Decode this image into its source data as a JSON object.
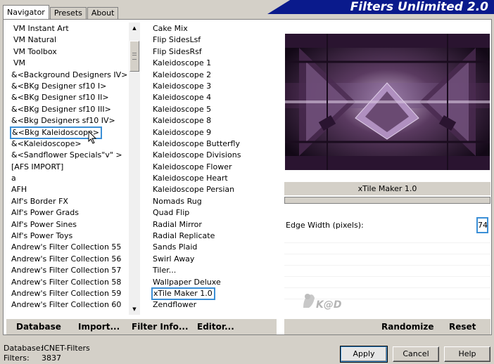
{
  "tabs": [
    "Navigator",
    "Presets",
    "About"
  ],
  "app_title": "Filters Unlimited 2.0",
  "categories": [
    "VM Instant Art",
    "VM Natural",
    "VM Toolbox",
    "VM",
    "&<Background Designers IV>",
    "&<BKg Designer sf10 I>",
    "&<BKg Designer sf10 II>",
    "&<BKg Designer sf10 III>",
    "&<Bkg Designers sf10 IV>",
    "&<Bkg Kaleidoscope>",
    "&<Kaleidoscope>",
    "&<Sandflower Specials\"v\" >",
    "[AFS IMPORT]",
    "a",
    "AFH",
    "Alf's Border FX",
    "Alf's Power Grads",
    "Alf's Power Sines",
    "Alf's Power Toys",
    "Andrew's Filter Collection 55",
    "Andrew's Filter Collection 56",
    "Andrew's Filter Collection 57",
    "Andrew's Filter Collection 58",
    "Andrew's Filter Collection 59",
    "Andrew's Filter Collection 60"
  ],
  "selected_category": "&<Bkg Kaleidoscope>",
  "filters": [
    "Cake Mix",
    "Flip SidesLsf",
    "Flip SidesRsf",
    "Kaleidoscope 1",
    "Kaleidoscope 2",
    "Kaleidoscope 3",
    "Kaleidoscope 4",
    "Kaleidoscope 5",
    "Kaleidoscope 8",
    "Kaleidoscope 9",
    "Kaleidoscope Butterfly",
    "Kaleidoscope Divisions",
    "Kaleidoscope Flower",
    "Kaleidoscope Heart",
    "Kaleidoscope Persian",
    "Nomads Rug",
    "Quad Flip",
    "Radial Mirror",
    "Radial Replicate",
    "Sands Plaid",
    "Swirl Away",
    "Tiler...",
    "Wallpaper Deluxe",
    "xTile Maker 1.0",
    "Zendflower"
  ],
  "selected_filter": "xTile Maker 1.0",
  "filter_name": "xTile Maker 1.0",
  "param": {
    "label": "Edge Width (pixels):",
    "value": "74"
  },
  "left_buttons": {
    "database": "Database",
    "import": "Import...",
    "filter_info": "Filter Info...",
    "editor": "Editor..."
  },
  "right_buttons": {
    "randomize": "Randomize",
    "reset": "Reset"
  },
  "status": {
    "db_label": "Database:",
    "db_value": "ICNET-Filters",
    "filters_label": "Filters:",
    "filters_value": "3837"
  },
  "dialog": {
    "apply": "Apply",
    "cancel": "Cancel",
    "help": "Help"
  },
  "watermark": "K@D",
  "colors": {
    "accent": "#3b8fd6",
    "banner": "#0a1a8c"
  }
}
